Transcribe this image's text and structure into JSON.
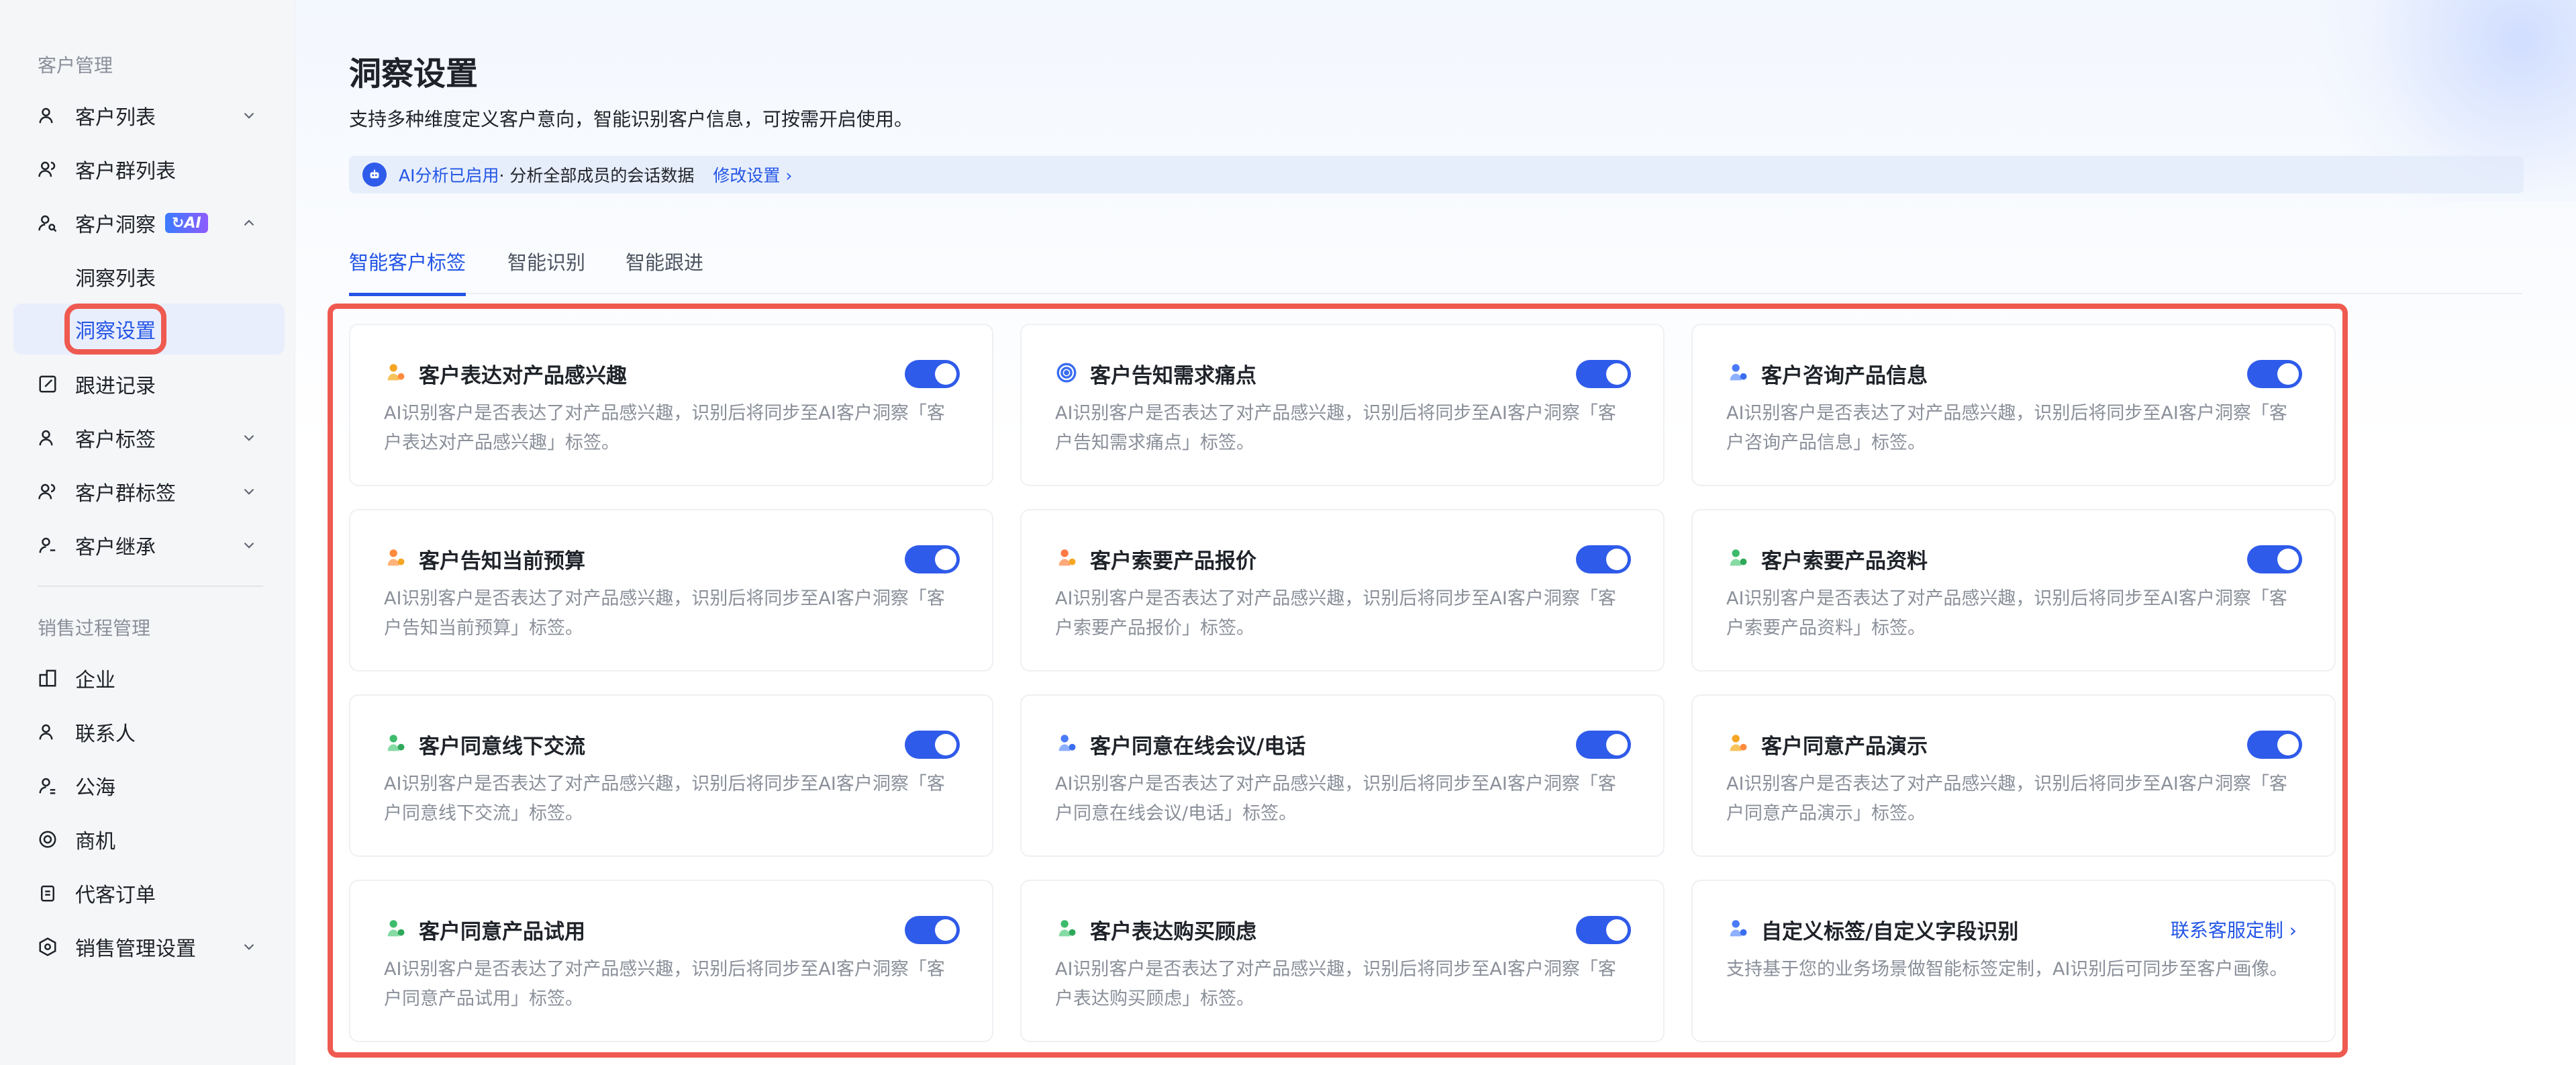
{
  "sidebar": {
    "group1_title": "客户管理",
    "group2_title": "销售过程管理",
    "items": {
      "customer_list": "客户列表",
      "customer_group_list": "客户群列表",
      "customer_insight": "客户洞察",
      "insight_badge": "AI",
      "insight_list": "洞察列表",
      "insight_settings": "洞察设置",
      "followup_records": "跟进记录",
      "customer_tags": "客户标签",
      "customer_group_tags": "客户群标签",
      "customer_inherit": "客户继承",
      "enterprise": "企业",
      "contacts": "联系人",
      "public_pool": "公海",
      "opportunity": "商机",
      "proxy_orders": "代客订单",
      "sales_settings": "销售管理设置"
    }
  },
  "header": {
    "title": "洞察设置",
    "description": "支持多种维度定义客户意向，智能识别客户信息，可按需开启使用。"
  },
  "ai_banner": {
    "status": "AI分析已启用",
    "detail": " · 分析全部成员的会话数据",
    "link": "修改设置 ›"
  },
  "tabs": [
    "智能客户标签",
    "智能识别",
    "智能跟进"
  ],
  "cards": [
    {
      "title": "客户表达对产品感兴趣",
      "desc": "AI识别客户是否表达了对产品感兴趣，识别后将同步至AI客户洞察「客户表达对产品感兴趣」标签。",
      "enabled": true
    },
    {
      "title": "客户告知需求痛点",
      "desc": "AI识别客户是否表达了对产品感兴趣，识别后将同步至AI客户洞察「客户告知需求痛点」标签。",
      "enabled": true
    },
    {
      "title": "客户咨询产品信息",
      "desc": "AI识别客户是否表达了对产品感兴趣，识别后将同步至AI客户洞察「客户咨询产品信息」标签。",
      "enabled": true
    },
    {
      "title": "客户告知当前预算",
      "desc": "AI识别客户是否表达了对产品感兴趣，识别后将同步至AI客户洞察「客户告知当前预算」标签。",
      "enabled": true
    },
    {
      "title": "客户索要产品报价",
      "desc": "AI识别客户是否表达了对产品感兴趣，识别后将同步至AI客户洞察「客户索要产品报价」标签。",
      "enabled": true
    },
    {
      "title": "客户索要产品资料",
      "desc": "AI识别客户是否表达了对产品感兴趣，识别后将同步至AI客户洞察「客户索要产品资料」标签。",
      "enabled": true
    },
    {
      "title": "客户同意线下交流",
      "desc": "AI识别客户是否表达了对产品感兴趣，识别后将同步至AI客户洞察「客户同意线下交流」标签。",
      "enabled": true
    },
    {
      "title": "客户同意在线会议/电话",
      "desc": "AI识别客户是否表达了对产品感兴趣，识别后将同步至AI客户洞察「客户同意在线会议/电话」标签。",
      "enabled": true
    },
    {
      "title": "客户同意产品演示",
      "desc": "AI识别客户是否表达了对产品感兴趣，识别后将同步至AI客户洞察「客户同意产品演示」标签。",
      "enabled": true
    },
    {
      "title": "客户同意产品试用",
      "desc": "AI识别客户是否表达了对产品感兴趣，识别后将同步至AI客户洞察「客户同意产品试用」标签。",
      "enabled": true
    },
    {
      "title": "客户表达购买顾虑",
      "desc": "AI识别客户是否表达了对产品感兴趣，识别后将同步至AI客户洞察「客户表达购买顾虑」标签。",
      "enabled": true
    },
    {
      "title": "自定义标签/自定义字段识别",
      "desc": "支持基于您的业务场景做智能标签定制，AI识别后可同步至客户画像。",
      "link": "联系客服定制 ›"
    }
  ],
  "colors": {
    "accent": "#2355e6",
    "toggle_on": "#2f5bea",
    "highlight": "#ef5a50"
  }
}
